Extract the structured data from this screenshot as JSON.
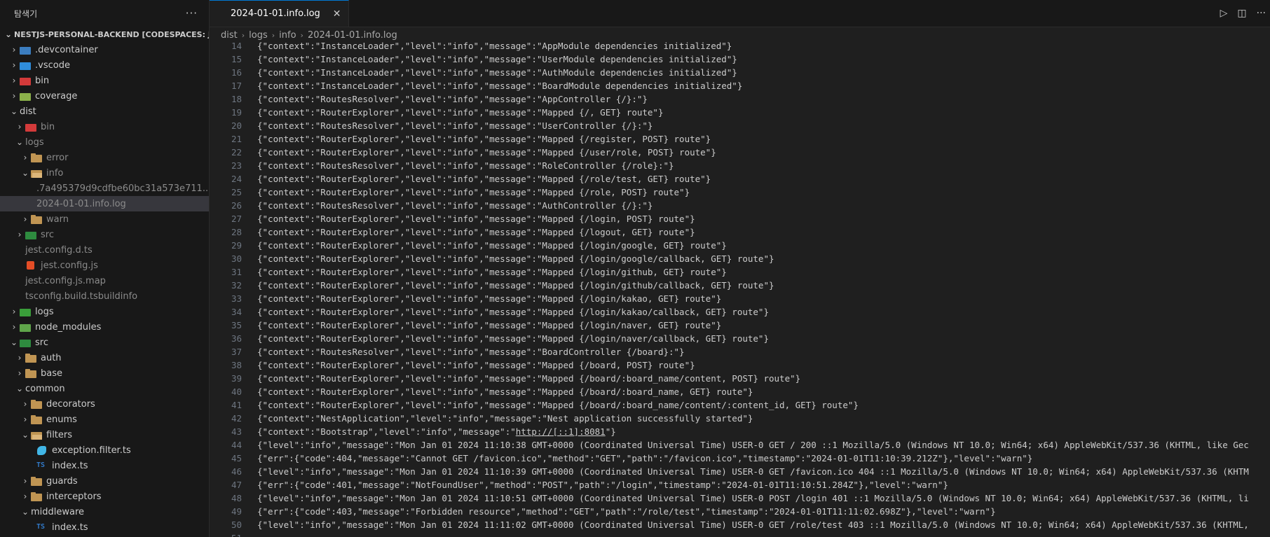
{
  "sidebar": {
    "title": "탐색기",
    "more": "···",
    "project": "NESTJS-PERSONAL-BACKEND [CODESPACES: JUBIL...",
    "items": [
      {
        "label": ".devcontainer",
        "depth": 1,
        "chev": "›",
        "icon": "devc",
        "dim": false
      },
      {
        "label": ".vscode",
        "depth": 1,
        "chev": "›",
        "icon": "vsc",
        "dim": false
      },
      {
        "label": "bin",
        "depth": 1,
        "chev": "›",
        "icon": "bin",
        "dim": false
      },
      {
        "label": "coverage",
        "depth": 1,
        "chev": "›",
        "icon": "cov",
        "dim": false
      },
      {
        "label": "dist",
        "depth": 1,
        "chev": "⌄",
        "icon": "none",
        "dim": false
      },
      {
        "label": "bin",
        "depth": 2,
        "chev": "›",
        "icon": "bin",
        "dim": true
      },
      {
        "label": "logs",
        "depth": 2,
        "chev": "⌄",
        "icon": "none",
        "dim": true
      },
      {
        "label": "error",
        "depth": 3,
        "chev": "›",
        "icon": "folder",
        "dim": true
      },
      {
        "label": "info",
        "depth": 3,
        "chev": "⌄",
        "icon": "folder-open",
        "dim": true
      },
      {
        "label": ".7a495379d9cdfbe60bc31a573e711...",
        "depth": 4,
        "chev": "",
        "icon": "none",
        "dim": true
      },
      {
        "label": "2024-01-01.info.log",
        "depth": 4,
        "chev": "",
        "icon": "none",
        "dim": true,
        "selected": true
      },
      {
        "label": "warn",
        "depth": 3,
        "chev": "›",
        "icon": "folder",
        "dim": true
      },
      {
        "label": "src",
        "depth": 2,
        "chev": "›",
        "icon": "src",
        "dim": true
      },
      {
        "label": "jest.config.d.ts",
        "depth": 2,
        "chev": "",
        "icon": "none",
        "dim": true
      },
      {
        "label": "jest.config.js",
        "depth": 2,
        "chev": "",
        "icon": "js-file",
        "dim": true
      },
      {
        "label": "jest.config.js.map",
        "depth": 2,
        "chev": "",
        "icon": "none",
        "dim": true
      },
      {
        "label": "tsconfig.build.tsbuildinfo",
        "depth": 2,
        "chev": "",
        "icon": "none",
        "dim": true
      },
      {
        "label": "logs",
        "depth": 1,
        "chev": "›",
        "icon": "logs",
        "dim": false
      },
      {
        "label": "node_modules",
        "depth": 1,
        "chev": "›",
        "icon": "node",
        "dim": false
      },
      {
        "label": "src",
        "depth": 1,
        "chev": "⌄",
        "icon": "src",
        "dim": false
      },
      {
        "label": "auth",
        "depth": 2,
        "chev": "›",
        "icon": "folder",
        "dim": false
      },
      {
        "label": "base",
        "depth": 2,
        "chev": "›",
        "icon": "folder",
        "dim": false
      },
      {
        "label": "common",
        "depth": 2,
        "chev": "⌄",
        "icon": "none",
        "dim": false
      },
      {
        "label": "decorators",
        "depth": 3,
        "chev": "›",
        "icon": "folder",
        "dim": false
      },
      {
        "label": "enums",
        "depth": 3,
        "chev": "›",
        "icon": "folder",
        "dim": false
      },
      {
        "label": "filters",
        "depth": 3,
        "chev": "⌄",
        "icon": "folder-open",
        "dim": false
      },
      {
        "label": "exception.filter.ts",
        "depth": 4,
        "chev": "",
        "icon": "ex-file",
        "dim": false
      },
      {
        "label": "index.ts",
        "depth": 4,
        "chev": "",
        "icon": "ts-file",
        "dim": false
      },
      {
        "label": "guards",
        "depth": 3,
        "chev": "›",
        "icon": "folder",
        "dim": false
      },
      {
        "label": "interceptors",
        "depth": 3,
        "chev": "›",
        "icon": "folder",
        "dim": false
      },
      {
        "label": "middleware",
        "depth": 3,
        "chev": "⌄",
        "icon": "none",
        "dim": false
      },
      {
        "label": "index.ts",
        "depth": 4,
        "chev": "",
        "icon": "ts-file",
        "dim": false
      }
    ]
  },
  "editor": {
    "tab_label": "2024-01-01.info.log",
    "tab_close": "✕",
    "actions": {
      "run": "▷",
      "split": "◫",
      "more": "···"
    },
    "breadcrumb": [
      "dist",
      "logs",
      "info",
      "2024-01-01.info.log"
    ],
    "lines": [
      {
        "n": "14",
        "t": "{\"context\":\"InstanceLoader\",\"level\":\"info\",\"message\":\"AppModule dependencies initialized\"}"
      },
      {
        "n": "15",
        "t": "{\"context\":\"InstanceLoader\",\"level\":\"info\",\"message\":\"UserModule dependencies initialized\"}"
      },
      {
        "n": "16",
        "t": "{\"context\":\"InstanceLoader\",\"level\":\"info\",\"message\":\"AuthModule dependencies initialized\"}"
      },
      {
        "n": "17",
        "t": "{\"context\":\"InstanceLoader\",\"level\":\"info\",\"message\":\"BoardModule dependencies initialized\"}"
      },
      {
        "n": "18",
        "t": "{\"context\":\"RoutesResolver\",\"level\":\"info\",\"message\":\"AppController {/}:\"}"
      },
      {
        "n": "19",
        "t": "{\"context\":\"RouterExplorer\",\"level\":\"info\",\"message\":\"Mapped {/, GET} route\"}"
      },
      {
        "n": "20",
        "t": "{\"context\":\"RoutesResolver\",\"level\":\"info\",\"message\":\"UserController {/}:\"}"
      },
      {
        "n": "21",
        "t": "{\"context\":\"RouterExplorer\",\"level\":\"info\",\"message\":\"Mapped {/register, POST} route\"}"
      },
      {
        "n": "22",
        "t": "{\"context\":\"RouterExplorer\",\"level\":\"info\",\"message\":\"Mapped {/user/role, POST} route\"}"
      },
      {
        "n": "23",
        "t": "{\"context\":\"RoutesResolver\",\"level\":\"info\",\"message\":\"RoleController {/role}:\"}"
      },
      {
        "n": "24",
        "t": "{\"context\":\"RouterExplorer\",\"level\":\"info\",\"message\":\"Mapped {/role/test, GET} route\"}"
      },
      {
        "n": "25",
        "t": "{\"context\":\"RouterExplorer\",\"level\":\"info\",\"message\":\"Mapped {/role, POST} route\"}"
      },
      {
        "n": "26",
        "t": "{\"context\":\"RoutesResolver\",\"level\":\"info\",\"message\":\"AuthController {/}:\"}"
      },
      {
        "n": "27",
        "t": "{\"context\":\"RouterExplorer\",\"level\":\"info\",\"message\":\"Mapped {/login, POST} route\"}"
      },
      {
        "n": "28",
        "t": "{\"context\":\"RouterExplorer\",\"level\":\"info\",\"message\":\"Mapped {/logout, GET} route\"}"
      },
      {
        "n": "29",
        "t": "{\"context\":\"RouterExplorer\",\"level\":\"info\",\"message\":\"Mapped {/login/google, GET} route\"}"
      },
      {
        "n": "30",
        "t": "{\"context\":\"RouterExplorer\",\"level\":\"info\",\"message\":\"Mapped {/login/google/callback, GET} route\"}"
      },
      {
        "n": "31",
        "t": "{\"context\":\"RouterExplorer\",\"level\":\"info\",\"message\":\"Mapped {/login/github, GET} route\"}"
      },
      {
        "n": "32",
        "t": "{\"context\":\"RouterExplorer\",\"level\":\"info\",\"message\":\"Mapped {/login/github/callback, GET} route\"}"
      },
      {
        "n": "33",
        "t": "{\"context\":\"RouterExplorer\",\"level\":\"info\",\"message\":\"Mapped {/login/kakao, GET} route\"}"
      },
      {
        "n": "34",
        "t": "{\"context\":\"RouterExplorer\",\"level\":\"info\",\"message\":\"Mapped {/login/kakao/callback, GET} route\"}"
      },
      {
        "n": "35",
        "t": "{\"context\":\"RouterExplorer\",\"level\":\"info\",\"message\":\"Mapped {/login/naver, GET} route\"}"
      },
      {
        "n": "36",
        "t": "{\"context\":\"RouterExplorer\",\"level\":\"info\",\"message\":\"Mapped {/login/naver/callback, GET} route\"}"
      },
      {
        "n": "37",
        "t": "{\"context\":\"RoutesResolver\",\"level\":\"info\",\"message\":\"BoardController {/board}:\"}"
      },
      {
        "n": "38",
        "t": "{\"context\":\"RouterExplorer\",\"level\":\"info\",\"message\":\"Mapped {/board, POST} route\"}"
      },
      {
        "n": "39",
        "t": "{\"context\":\"RouterExplorer\",\"level\":\"info\",\"message\":\"Mapped {/board/:board_name/content, POST} route\"}"
      },
      {
        "n": "40",
        "t": "{\"context\":\"RouterExplorer\",\"level\":\"info\",\"message\":\"Mapped {/board/:board_name, GET} route\"}"
      },
      {
        "n": "41",
        "t": "{\"context\":\"RouterExplorer\",\"level\":\"info\",\"message\":\"Mapped {/board/:board_name/content/:content_id, GET} route\"}"
      },
      {
        "n": "42",
        "t": "{\"context\":\"NestApplication\",\"level\":\"info\",\"message\":\"Nest application successfully started\"}"
      },
      {
        "n": "43",
        "t": "{\"context\":\"Bootstrap\",\"level\":\"info\",\"message\":\"",
        "link": "http://[::1]:8081",
        "t2": "\"}"
      },
      {
        "n": "44",
        "t": "{\"level\":\"info\",\"message\":\"Mon Jan 01 2024 11:10:38 GMT+0000 (Coordinated Universal Time) USER-0 GET / 200 ::1 Mozilla/5.0 (Windows NT 10.0; Win64; x64) AppleWebKit/537.36 (KHTML, like Gec"
      },
      {
        "n": "45",
        "t": "{\"err\":{\"code\":404,\"message\":\"Cannot GET /favicon.ico\",\"method\":\"GET\",\"path\":\"/favicon.ico\",\"timestamp\":\"2024-01-01T11:10:39.212Z\"},\"level\":\"warn\"}"
      },
      {
        "n": "46",
        "t": "{\"level\":\"info\",\"message\":\"Mon Jan 01 2024 11:10:39 GMT+0000 (Coordinated Universal Time) USER-0 GET /favicon.ico 404 ::1 Mozilla/5.0 (Windows NT 10.0; Win64; x64) AppleWebKit/537.36 (KHTM"
      },
      {
        "n": "47",
        "t": "{\"err\":{\"code\":401,\"message\":\"NotFoundUser\",\"method\":\"POST\",\"path\":\"/login\",\"timestamp\":\"2024-01-01T11:10:51.284Z\"},\"level\":\"warn\"}"
      },
      {
        "n": "48",
        "t": "{\"level\":\"info\",\"message\":\"Mon Jan 01 2024 11:10:51 GMT+0000 (Coordinated Universal Time) USER-0 POST /login 401 ::1 Mozilla/5.0 (Windows NT 10.0; Win64; x64) AppleWebKit/537.36 (KHTML, li"
      },
      {
        "n": "49",
        "t": "{\"err\":{\"code\":403,\"message\":\"Forbidden resource\",\"method\":\"GET\",\"path\":\"/role/test\",\"timestamp\":\"2024-01-01T11:11:02.698Z\"},\"level\":\"warn\"}"
      },
      {
        "n": "50",
        "t": "{\"level\":\"info\",\"message\":\"Mon Jan 01 2024 11:11:02 GMT+0000 (Coordinated Universal Time) USER-0 GET /role/test 403 ::1 Mozilla/5.0 (Windows NT 10.0; Win64; x64) AppleWebKit/537.36 (KHTML,"
      },
      {
        "n": "51",
        "t": ""
      }
    ]
  }
}
